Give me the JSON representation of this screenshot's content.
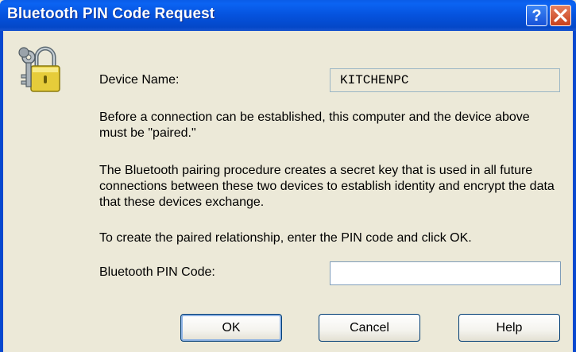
{
  "window": {
    "title": "Bluetooth PIN Code Request",
    "help_glyph": "?",
    "icons": {
      "dialog": "keys-padlock-icon",
      "help": "help-icon",
      "close": "close-icon"
    }
  },
  "device": {
    "label": "Device Name:",
    "value": "KITCHENPC"
  },
  "paragraphs": {
    "p1": "Before a connection can be established, this computer and the device above must be \"paired.\"",
    "p2": "The Bluetooth pairing procedure creates a secret key that is used in all future connections between these two devices to establish identity and encrypt the data that these devices exchange.",
    "p3": "To create the paired relationship, enter the PIN code and click OK."
  },
  "pin": {
    "label": "Bluetooth PIN Code:",
    "value": ""
  },
  "buttons": {
    "ok": "OK",
    "cancel": "Cancel",
    "help": "Help"
  }
}
